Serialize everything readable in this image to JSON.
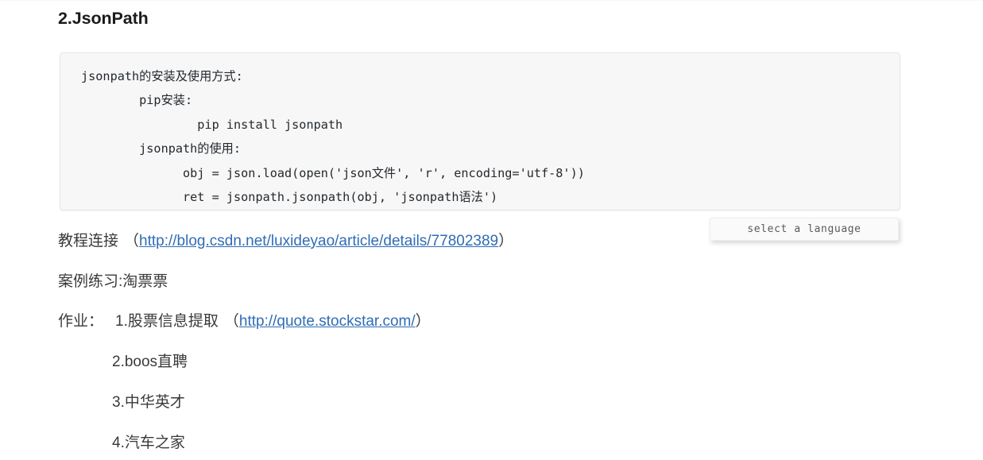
{
  "page": {
    "heading": "2.JsonPath",
    "background_color": "#ffffff",
    "text_color": "#3a3a3a",
    "link_color": "#2f6cb5"
  },
  "code_block": {
    "background_color": "#f7f7f7",
    "border_color": "#e4e4e4",
    "lines": [
      "jsonpath的安装及使用方式:",
      "        pip安装:",
      "                pip install jsonpath",
      "        jsonpath的使用:",
      "              obj = json.load(open('json文件', 'r', encoding='utf-8'))",
      "              ret = jsonpath.jsonpath(obj, 'jsonpath语法')"
    ],
    "text": "jsonpath的安装及使用方式:\n        pip安装:\n                pip install jsonpath\n        jsonpath的使用:\n              obj = json.load(open('json文件', 'r', encoding='utf-8'))\n              ret = jsonpath.jsonpath(obj, 'jsonpath语法')"
  },
  "language_select": {
    "label": "select a language",
    "background_color": "#fafafa"
  },
  "tutorial": {
    "label": "教程连接",
    "open_paren": "（",
    "link_text": "http://blog.csdn.net/luxideyao/article/details/77802389",
    "close_paren": "）"
  },
  "case_study": {
    "text": "案例练习:淘票票"
  },
  "homework": {
    "label": "作业：",
    "item1_text": "1.股票信息提取",
    "item1_open_paren": "（",
    "item1_link_text": "http://quote.stockstar.com/",
    "item1_close_paren": "）",
    "items": [
      "2.boos直聘",
      "3.中华英才",
      "4.汽车之家"
    ]
  }
}
